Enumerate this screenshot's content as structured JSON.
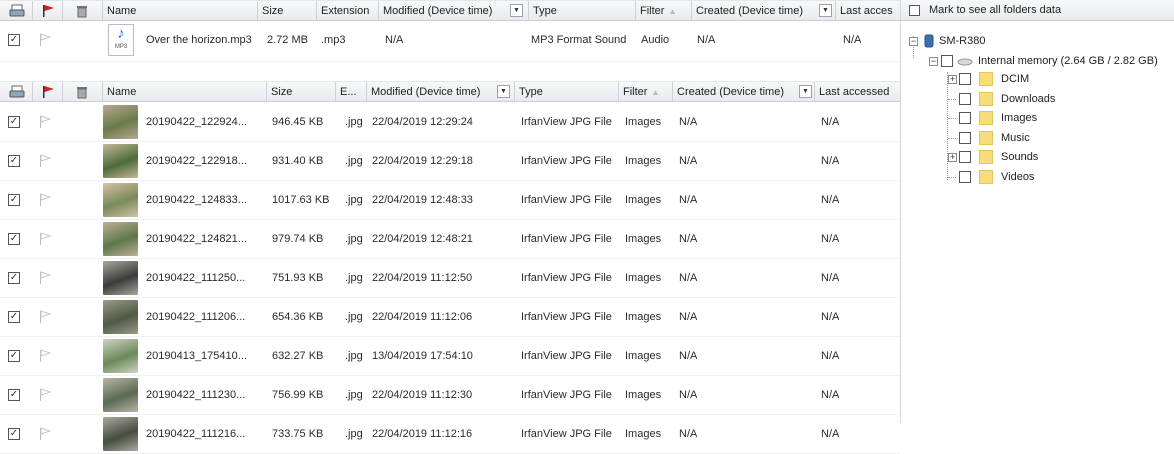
{
  "top_header": {
    "name": "Name",
    "size": "Size",
    "extension": "Extension",
    "modified": "Modified (Device time)",
    "type": "Type",
    "filter": "Filter",
    "created": "Created (Device time)",
    "last": "Last acces"
  },
  "mp3_row": {
    "name": "Over the horizon.mp3",
    "size": "2.72 MB",
    "ext": ".mp3",
    "modified": "N/A",
    "type": "MP3 Format Sound",
    "filter": "Audio",
    "created": "N/A",
    "last": "N/A",
    "icon_label": "MP3"
  },
  "second_header": {
    "name": "Name",
    "size": "Size",
    "extension": "E...",
    "modified": "Modified (Device time)",
    "type": "Type",
    "filter": "Filter",
    "created": "Created (Device time)",
    "last": "Last accessed"
  },
  "rows": [
    {
      "name": "20190422_122924...",
      "size": "946.45 KB",
      "ext": ".jpg",
      "modified": "22/04/2019 12:29:24",
      "type": "IrfanView JPG File",
      "filter": "Images",
      "created": "N/A",
      "last": "N/A"
    },
    {
      "name": "20190422_122918...",
      "size": "931.40 KB",
      "ext": ".jpg",
      "modified": "22/04/2019 12:29:18",
      "type": "IrfanView JPG File",
      "filter": "Images",
      "created": "N/A",
      "last": "N/A"
    },
    {
      "name": "20190422_124833...",
      "size": "1017.63 KB",
      "ext": ".jpg",
      "modified": "22/04/2019 12:48:33",
      "type": "IrfanView JPG File",
      "filter": "Images",
      "created": "N/A",
      "last": "N/A"
    },
    {
      "name": "20190422_124821...",
      "size": "979.74 KB",
      "ext": ".jpg",
      "modified": "22/04/2019 12:48:21",
      "type": "IrfanView JPG File",
      "filter": "Images",
      "created": "N/A",
      "last": "N/A"
    },
    {
      "name": "20190422_111250...",
      "size": "751.93 KB",
      "ext": ".jpg",
      "modified": "22/04/2019 11:12:50",
      "type": "IrfanView JPG File",
      "filter": "Images",
      "created": "N/A",
      "last": "N/A"
    },
    {
      "name": "20190422_111206...",
      "size": "654.36 KB",
      "ext": ".jpg",
      "modified": "22/04/2019 11:12:06",
      "type": "IrfanView JPG File",
      "filter": "Images",
      "created": "N/A",
      "last": "N/A"
    },
    {
      "name": "20190413_175410...",
      "size": "632.27 KB",
      "ext": ".jpg",
      "modified": "13/04/2019 17:54:10",
      "type": "IrfanView JPG File",
      "filter": "Images",
      "created": "N/A",
      "last": "N/A"
    },
    {
      "name": "20190422_111230...",
      "size": "756.99 KB",
      "ext": ".jpg",
      "modified": "22/04/2019 11:12:30",
      "type": "IrfanView JPG File",
      "filter": "Images",
      "created": "N/A",
      "last": "N/A"
    },
    {
      "name": "20190422_111216...",
      "size": "733.75 KB",
      "ext": ".jpg",
      "modified": "22/04/2019 11:12:16",
      "type": "IrfanView JPG File",
      "filter": "Images",
      "created": "N/A",
      "last": "N/A"
    }
  ],
  "panel": {
    "mark_label": "Mark to see all folders data",
    "device": "SM-R380",
    "memory": "Internal memory (2.64 GB / 2.82 GB)",
    "folders": [
      {
        "name": "DCIM"
      },
      {
        "name": "Downloads"
      },
      {
        "name": "Images"
      },
      {
        "name": "Music"
      },
      {
        "name": "Sounds"
      },
      {
        "name": "Videos"
      }
    ]
  },
  "colors": {
    "accent_red": "#d42020",
    "folder": "#f7dc7a",
    "header": "#e8ebef"
  }
}
